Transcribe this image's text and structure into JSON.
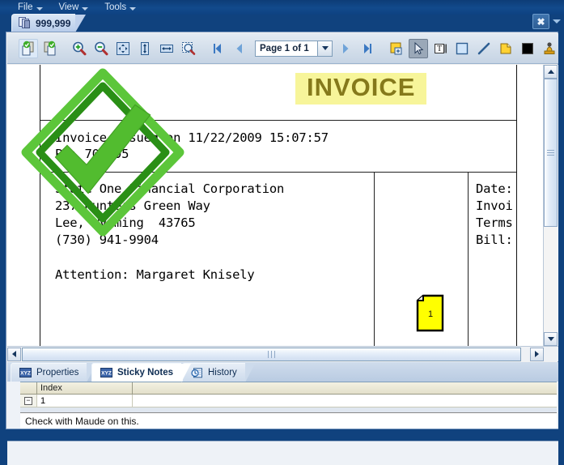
{
  "menu": {
    "items": [
      {
        "label": "File"
      },
      {
        "label": "View"
      },
      {
        "label": "Tools"
      }
    ]
  },
  "window": {
    "close_label": "✖",
    "close_icon": "close-icon",
    "dropdown_icon": "chevron-down-icon"
  },
  "document_tab": {
    "label": "999,999",
    "icon": "documents-icon"
  },
  "toolbar": {
    "buttons": [
      {
        "name": "import-page-button",
        "icon": "page-import-icon",
        "state": "hot"
      },
      {
        "name": "export-page-button",
        "icon": "page-export-icon",
        "state": "normal"
      },
      {
        "name": "zoom-in-button",
        "icon": "magnifier-plus-icon",
        "state": "normal"
      },
      {
        "name": "zoom-out-button",
        "icon": "magnifier-minus-icon",
        "state": "normal"
      },
      {
        "name": "fit-page-button",
        "icon": "fit-page-icon",
        "state": "normal"
      },
      {
        "name": "fit-height-button",
        "icon": "fit-height-icon",
        "state": "normal"
      },
      {
        "name": "fit-width-button",
        "icon": "fit-width-icon",
        "state": "normal"
      },
      {
        "name": "zoom-area-button",
        "icon": "magnifier-select-icon",
        "state": "normal"
      },
      {
        "name": "first-page-button",
        "icon": "first-page-icon",
        "state": "normal"
      },
      {
        "name": "previous-page-button",
        "icon": "previous-page-icon",
        "state": "normal"
      },
      {
        "name": "next-page-button",
        "icon": "next-page-icon",
        "state": "normal"
      },
      {
        "name": "last-page-button",
        "icon": "last-page-icon",
        "state": "normal"
      },
      {
        "name": "new-annotation-button",
        "icon": "stamp-new-icon",
        "state": "normal"
      },
      {
        "name": "select-tool-button",
        "icon": "arrow-cursor-icon",
        "state": "selected"
      },
      {
        "name": "text-annotation-button",
        "icon": "text-box-icon",
        "state": "normal"
      },
      {
        "name": "rectangle-annotation-button",
        "icon": "rectangle-icon",
        "state": "normal"
      },
      {
        "name": "line-annotation-button",
        "icon": "line-icon",
        "state": "normal"
      },
      {
        "name": "sticky-note-button",
        "icon": "sticky-note-icon",
        "state": "normal"
      },
      {
        "name": "redaction-button",
        "icon": "black-box-icon",
        "state": "normal"
      },
      {
        "name": "stamp-button",
        "icon": "rubber-stamp-icon",
        "state": "normal"
      },
      {
        "name": "lock-annotations-button",
        "icon": "lock-icon",
        "state": "disabled"
      },
      {
        "name": "help-button",
        "icon": "question-help-icon",
        "state": "normal"
      }
    ],
    "page_value": "Page 1 of 1",
    "page_dropdown_icon": "chevron-down-icon"
  },
  "viewer": {
    "invoice_badge": "INVOICE",
    "lines": [
      "Invoice issued on 11/22/2009 15:07:57",
      "PO: 706895",
      "State One Financial Corporation",
      "237 Hunters Green Way",
      "Lee, Wyoming  43765",
      "(730) 941-9904",
      "Attention: Margaret Knisely"
    ],
    "right_fields": [
      "Date:",
      "Invoi",
      "Terms",
      "Bill:"
    ],
    "note_marker_label": "1",
    "stamp_icon": "green-check-stamp",
    "stamp_color": "#4FBF30"
  },
  "scrollbars": {
    "up_icon": "arrow-up-icon",
    "down_icon": "arrow-down-icon",
    "left_icon": "arrow-left-icon",
    "right_icon": "arrow-right-icon"
  },
  "panel": {
    "tabs": [
      {
        "label": "Properties",
        "icon": "xyz-properties-icon",
        "active": false
      },
      {
        "label": "Sticky Notes",
        "icon": "xyz-notes-icon",
        "active": true
      },
      {
        "label": "History",
        "icon": "clock-history-icon",
        "active": false
      }
    ],
    "grid": {
      "headers": [
        "",
        "Index",
        ""
      ],
      "rows": [
        {
          "expander": "−",
          "index": "1",
          "extra": ""
        }
      ]
    },
    "note_text": "Check with Maude on this."
  },
  "colors": {
    "title_bar": "#10427e",
    "toolbar_top": "#e4ebf3",
    "accent": "#2d5e96",
    "highlight_yellow": "#f7f59a",
    "note_yellow": "#ffff00",
    "stamp_green": "#4FBF30"
  }
}
